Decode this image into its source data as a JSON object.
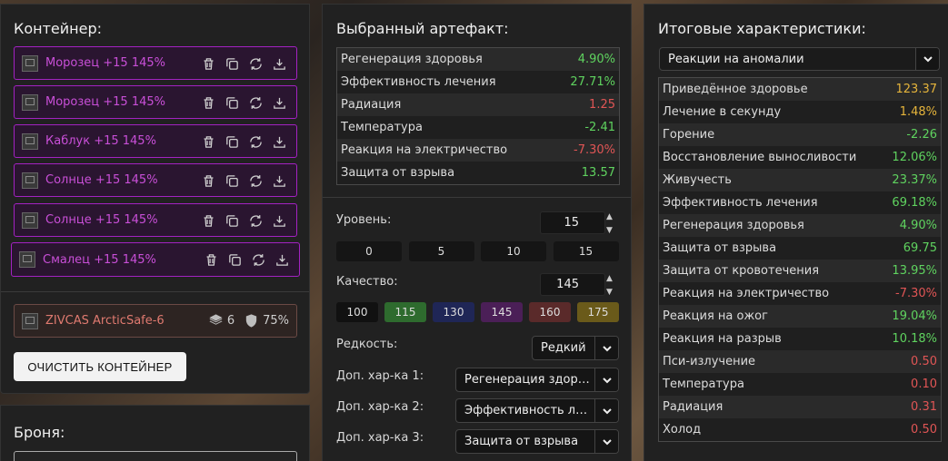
{
  "container_panel": {
    "title": "Контейнер:",
    "artifacts": [
      {
        "name": "Морозец +15 145%",
        "img_alt": "Мо"
      },
      {
        "name": "Морозец +15 145%",
        "img_alt": "Мо"
      },
      {
        "name": "Каблук +15 145%",
        "img_alt": "Ка"
      },
      {
        "name": "Солнце +15 145%",
        "img_alt": "Сол"
      },
      {
        "name": "Солнце +15 145%",
        "img_alt": "Сол"
      },
      {
        "name": "Смалец +15 145%",
        "img_alt": "Сма"
      }
    ],
    "container": {
      "name": "ZIVCAS ArcticSafe-6",
      "slots": "6",
      "protection": "75%"
    },
    "clear_button": "ОЧИСТИТЬ КОНТЕЙНЕР"
  },
  "armor_panel": {
    "title": "Броня:"
  },
  "selected_panel": {
    "title": "Выбранный артефакт:",
    "stats": [
      {
        "label": "Регенерация здоровья",
        "value": "4.90%",
        "tone": "pos"
      },
      {
        "label": "Эффективность лечения",
        "value": "27.71%",
        "tone": "pos"
      },
      {
        "label": "Радиация",
        "value": "1.25",
        "tone": "neg"
      },
      {
        "label": "Температура",
        "value": "-2.41",
        "tone": "pos"
      },
      {
        "label": "Реакция на электричество",
        "value": "-7.30%",
        "tone": "neg"
      },
      {
        "label": "Защита от взрыва",
        "value": "13.57",
        "tone": "pos"
      }
    ],
    "level": {
      "label": "Уровень:",
      "value": "15",
      "presets": [
        "0",
        "5",
        "10",
        "15"
      ]
    },
    "quality": {
      "label": "Качество:",
      "value": "145",
      "presets": [
        {
          "label": "100",
          "color": "#111111"
        },
        {
          "label": "115",
          "color": "#2e6b2e"
        },
        {
          "label": "130",
          "color": "#1f2656"
        },
        {
          "label": "145",
          "color": "#4b1f57"
        },
        {
          "label": "160",
          "color": "#5a2a2a"
        },
        {
          "label": "175",
          "color": "#6a5a1a"
        }
      ]
    },
    "rarity": {
      "label": "Редкость:",
      "value": "Редкий"
    },
    "extra": [
      {
        "label": "Доп. хар-ка 1:",
        "value": "Регенерация здоровья"
      },
      {
        "label": "Доп. хар-ка 2:",
        "value": "Эффективность лечения"
      },
      {
        "label": "Доп. хар-ка 3:",
        "value": "Защита от взрыва"
      }
    ]
  },
  "final_panel": {
    "title": "Итоговые характеристики:",
    "mode": "Реакции на аномалии",
    "stats": [
      {
        "label": "Приведённое здоровье",
        "value": "123.37",
        "tone": "warn"
      },
      {
        "label": "Лечение в секунду",
        "value": "1.48%",
        "tone": "warn"
      },
      {
        "label": "Горение",
        "value": "-2.26",
        "tone": "pos"
      },
      {
        "label": "Восстановление выносливости",
        "value": "12.06%",
        "tone": "pos"
      },
      {
        "label": "Живучесть",
        "value": "23.37%",
        "tone": "pos"
      },
      {
        "label": "Эффективность лечения",
        "value": "69.18%",
        "tone": "pos"
      },
      {
        "label": "Регенерация здоровья",
        "value": "4.90%",
        "tone": "pos"
      },
      {
        "label": "Защита от взрыва",
        "value": "69.75",
        "tone": "pos"
      },
      {
        "label": "Защита от кровотечения",
        "value": "13.95%",
        "tone": "pos"
      },
      {
        "label": "Реакция на электричество",
        "value": "-7.30%",
        "tone": "neg"
      },
      {
        "label": "Реакция на ожог",
        "value": "19.04%",
        "tone": "pos"
      },
      {
        "label": "Реакция на разрыв",
        "value": "10.18%",
        "tone": "pos"
      },
      {
        "label": "Пси-излучение",
        "value": "0.50",
        "tone": "neg"
      },
      {
        "label": "Температура",
        "value": "0.10",
        "tone": "neg"
      },
      {
        "label": "Радиация",
        "value": "0.31",
        "tone": "neg"
      },
      {
        "label": "Холод",
        "value": "0.50",
        "tone": "neg"
      }
    ]
  }
}
